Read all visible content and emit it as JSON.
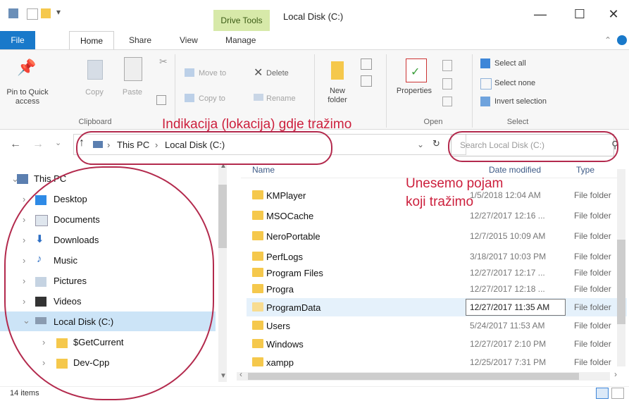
{
  "window": {
    "title": "Local Disk (C:)",
    "context_tab": "Drive Tools",
    "buttons": {
      "minimize": "—",
      "maximize": "☐",
      "close": "✕"
    }
  },
  "tabs": [
    "File",
    "Home",
    "Share",
    "View",
    "Manage"
  ],
  "ribbon": {
    "pin_to_quick_access": "Pin to Quick access",
    "copy": "Copy",
    "paste": "Paste",
    "move_to": "Move to",
    "copy_to": "Copy to",
    "delete": "Delete",
    "rename": "Rename",
    "new_folder": "New folder",
    "properties": "Properties",
    "select_all": "Select all",
    "select_none": "Select none",
    "invert_selection": "Invert selection",
    "groups": {
      "clipboard": "Clipboard",
      "open": "Open",
      "select": "Select"
    }
  },
  "address": {
    "path": [
      "This PC",
      "Local Disk (C:)"
    ],
    "search_placeholder": "Search Local Disk (C:)"
  },
  "nav": {
    "items": [
      {
        "label": "This PC",
        "icon": "computer-icon",
        "expanded": true
      },
      {
        "label": "Desktop",
        "icon": "desktop-icon"
      },
      {
        "label": "Documents",
        "icon": "documents-icon"
      },
      {
        "label": "Downloads",
        "icon": "downloads-icon"
      },
      {
        "label": "Music",
        "icon": "music-icon"
      },
      {
        "label": "Pictures",
        "icon": "pictures-icon"
      },
      {
        "label": "Videos",
        "icon": "videos-icon"
      },
      {
        "label": "Local Disk (C:)",
        "icon": "drive-icon",
        "selected": true
      },
      {
        "label": "$GetCurrent",
        "icon": "folder-icon"
      },
      {
        "label": "Dev-Cpp",
        "icon": "folder-icon"
      }
    ]
  },
  "columns": {
    "name": "Name",
    "date": "Date modified",
    "type": "Type"
  },
  "files": [
    {
      "name": "KMPlayer",
      "date": "1/5/2018 12:04 AM",
      "type": "File folder"
    },
    {
      "name": "MSOCache",
      "date": "12/27/2017 12:16 ...",
      "type": "File folder"
    },
    {
      "name": "NeroPortable",
      "date": "12/7/2015 10:09 AM",
      "type": "File folder"
    },
    {
      "name": "PerfLogs",
      "date": "3/18/2017 10:03 PM",
      "type": "File folder"
    },
    {
      "name": "Program Files",
      "date": "12/27/2017 12:17 ...",
      "type": "File folder"
    },
    {
      "name": "Progra",
      "date": "12/27/2017 12:18 ...",
      "type": "File folder"
    },
    {
      "name": "ProgramData",
      "date": "12/27/2017 11:35 AM",
      "type": "File folder"
    },
    {
      "name": "Users",
      "date": "5/24/2017 11:53 AM",
      "type": "File folder"
    },
    {
      "name": "Windows",
      "date": "12/27/2017 2:10 PM",
      "type": "File folder"
    },
    {
      "name": "xampp",
      "date": "12/25/2017 7:31 PM",
      "type": "File folder"
    }
  ],
  "status": {
    "items": "14 items"
  },
  "annotations": {
    "location": "Indikacija (lokacija) gdje tražimo",
    "search_line1": "Unesemo pojam",
    "search_line2": "koji tražimo"
  },
  "colors": {
    "accent": "#1979ca",
    "drive_tools": "#d7e9a9",
    "annotation": "#cc1f3c",
    "folder": "#f5c84c"
  }
}
